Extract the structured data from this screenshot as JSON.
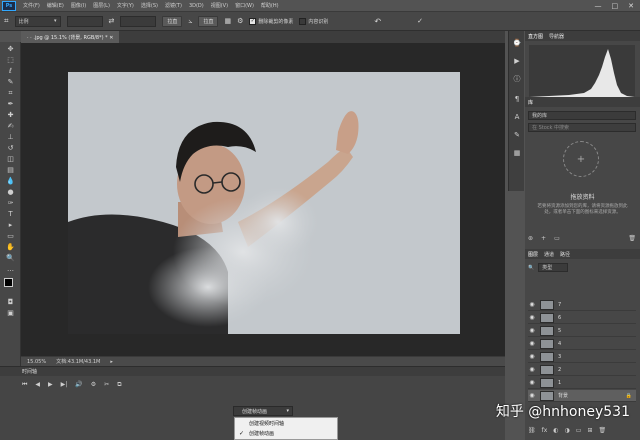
{
  "app": {
    "logo": "Ps"
  },
  "menubar": {
    "items": [
      "文件(F)",
      "编辑(E)",
      "图像(I)",
      "图层(L)",
      "文字(Y)",
      "选择(S)",
      "滤镜(T)",
      "3D(D)",
      "视图(V)",
      "窗口(W)",
      "帮助(H)"
    ],
    "minimize": "—",
    "maximize": "□",
    "close": "✕"
  },
  "options": {
    "ratio_select": "比例",
    "straighten_btn": "拉直",
    "grid_btn": "拉直",
    "checkbox1": "删除裁剪的像素",
    "checkbox2": "内容识别",
    "reset_icon": "↶",
    "commit_icon": "✓"
  },
  "document": {
    "tab_label": "· · .jpg @ 15.1% (背景, RGB/8*) *",
    "close": "✕"
  },
  "status": {
    "zoom": "15.05%",
    "doc": "文档:43.1M/43.1M"
  },
  "timeline": {
    "header": "时间轴",
    "dropdown_label": "创建帧动画",
    "menu_items": [
      {
        "label": "创建视频时间轴",
        "checked": false
      },
      {
        "label": "创建帧动画",
        "checked": true
      }
    ]
  },
  "histogram": {
    "tabs": [
      "直方图",
      "导航器"
    ]
  },
  "libraries": {
    "tab": "库",
    "select": "我的库",
    "search": "在 Stock 中搜索",
    "title": "拖放资料",
    "desc": "若要将资源添加到您的库，请将资源拖放到此处，或者单击下面的图标来选择资源。"
  },
  "layers": {
    "tabs": [
      "图层",
      "通道",
      "路径"
    ],
    "kind": "类型",
    "items": [
      "7",
      "6",
      "5",
      "4",
      "3",
      "2",
      "1",
      "背景"
    ]
  },
  "watermark": "知乎 @hnhoney531",
  "colors": {
    "accent": "#31a8ff"
  }
}
